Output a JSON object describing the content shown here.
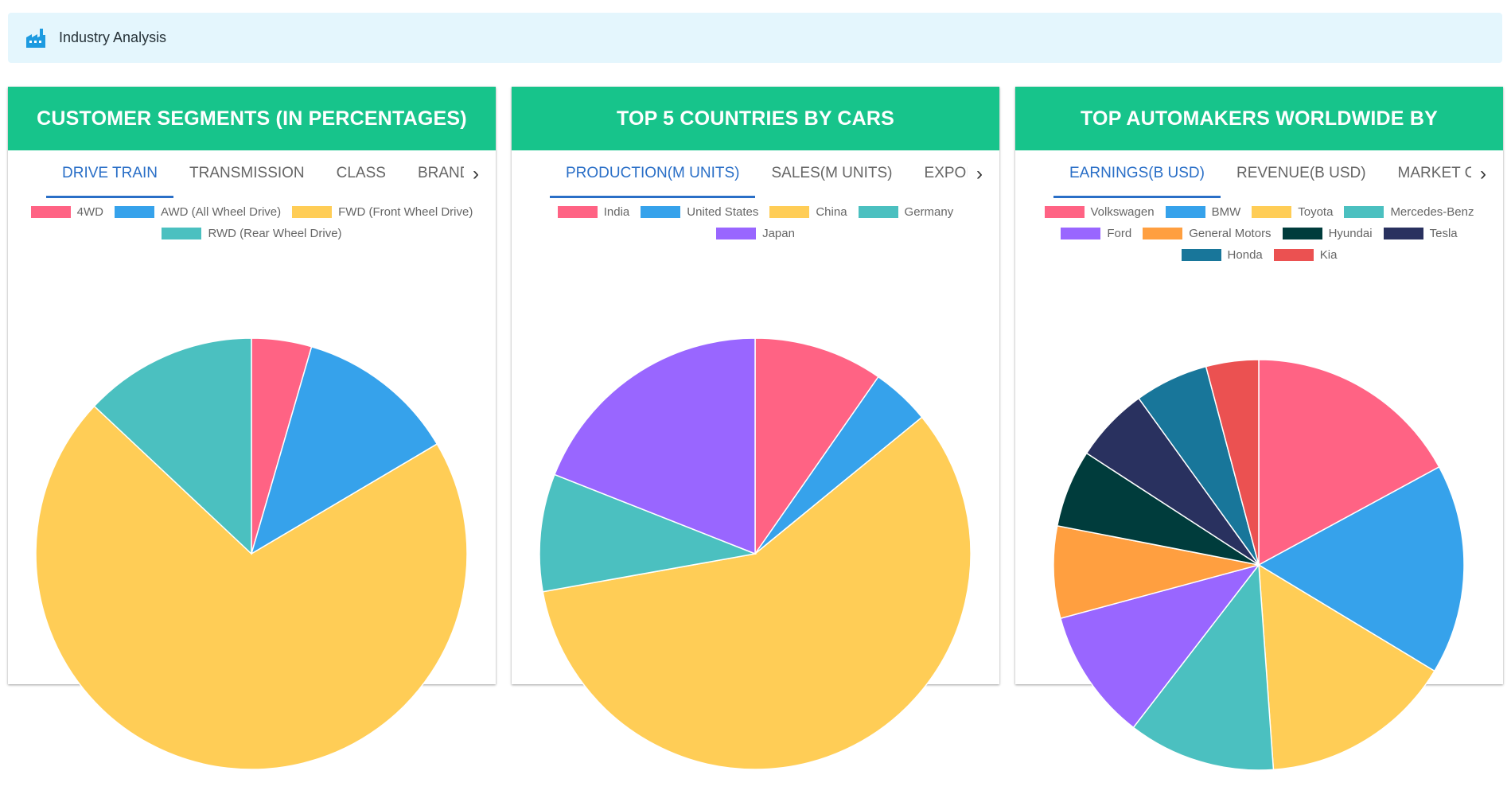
{
  "header": {
    "title": "Industry Analysis",
    "icon": "factory-icon"
  },
  "panels": [
    {
      "title": "CUSTOMER SEGMENTS (IN PERCENTAGES)",
      "tabs": [
        "DRIVE TRAIN",
        "TRANSMISSION",
        "CLASS",
        "BRAND"
      ],
      "active_tab": 0
    },
    {
      "title": "TOP 5 COUNTRIES BY CARS",
      "tabs": [
        "PRODUCTION(M UNITS)",
        "SALES(M UNITS)",
        "EXPORTS"
      ],
      "active_tab": 0
    },
    {
      "title": "TOP AUTOMAKERS WORLDWIDE BY",
      "tabs": [
        "EARNINGS(B USD)",
        "REVENUE(B USD)",
        "MARKET CAP"
      ],
      "active_tab": 0
    }
  ],
  "chart_data": [
    {
      "type": "pie",
      "title": "CUSTOMER SEGMENTS (IN PERCENTAGES)",
      "legend_position": "top",
      "labels": [
        "4WD",
        "AWD (All Wheel Drive)",
        "FWD (Front Wheel Drive)",
        "RWD (Rear Wheel Drive)"
      ],
      "values": [
        4.5,
        12,
        70.5,
        13
      ],
      "colors": [
        "#ff6384",
        "#36a2eb",
        "#ffcd56",
        "#4bc0c0"
      ]
    },
    {
      "type": "pie",
      "title": "TOP 5 COUNTRIES BY CARS",
      "legend_position": "top",
      "labels": [
        "India",
        "United States",
        "China",
        "Germany",
        "Japan"
      ],
      "values": [
        5.5,
        2.5,
        33,
        5,
        10.8
      ],
      "colors": [
        "#ff6384",
        "#36a2eb",
        "#ffcd56",
        "#4bc0c0",
        "#9966ff"
      ]
    },
    {
      "type": "pie",
      "title": "TOP AUTOMAKERS WORLDWIDE BY",
      "legend_position": "top",
      "labels": [
        "Volkswagen",
        "BMW",
        "Toyota",
        "Mercedes-Benz",
        "Ford",
        "General Motors",
        "Hyundai",
        "Tesla",
        "Honda",
        "Kia"
      ],
      "values": [
        16.5,
        16,
        14.7,
        11.2,
        10,
        7,
        5.9,
        5.7,
        5.6,
        4
      ],
      "colors": [
        "#ff6384",
        "#36a2eb",
        "#ffcd56",
        "#4bc0c0",
        "#9966ff",
        "#ff9f40",
        "#003c3c",
        "#29315f",
        "#18769a",
        "#eb5151"
      ]
    }
  ]
}
